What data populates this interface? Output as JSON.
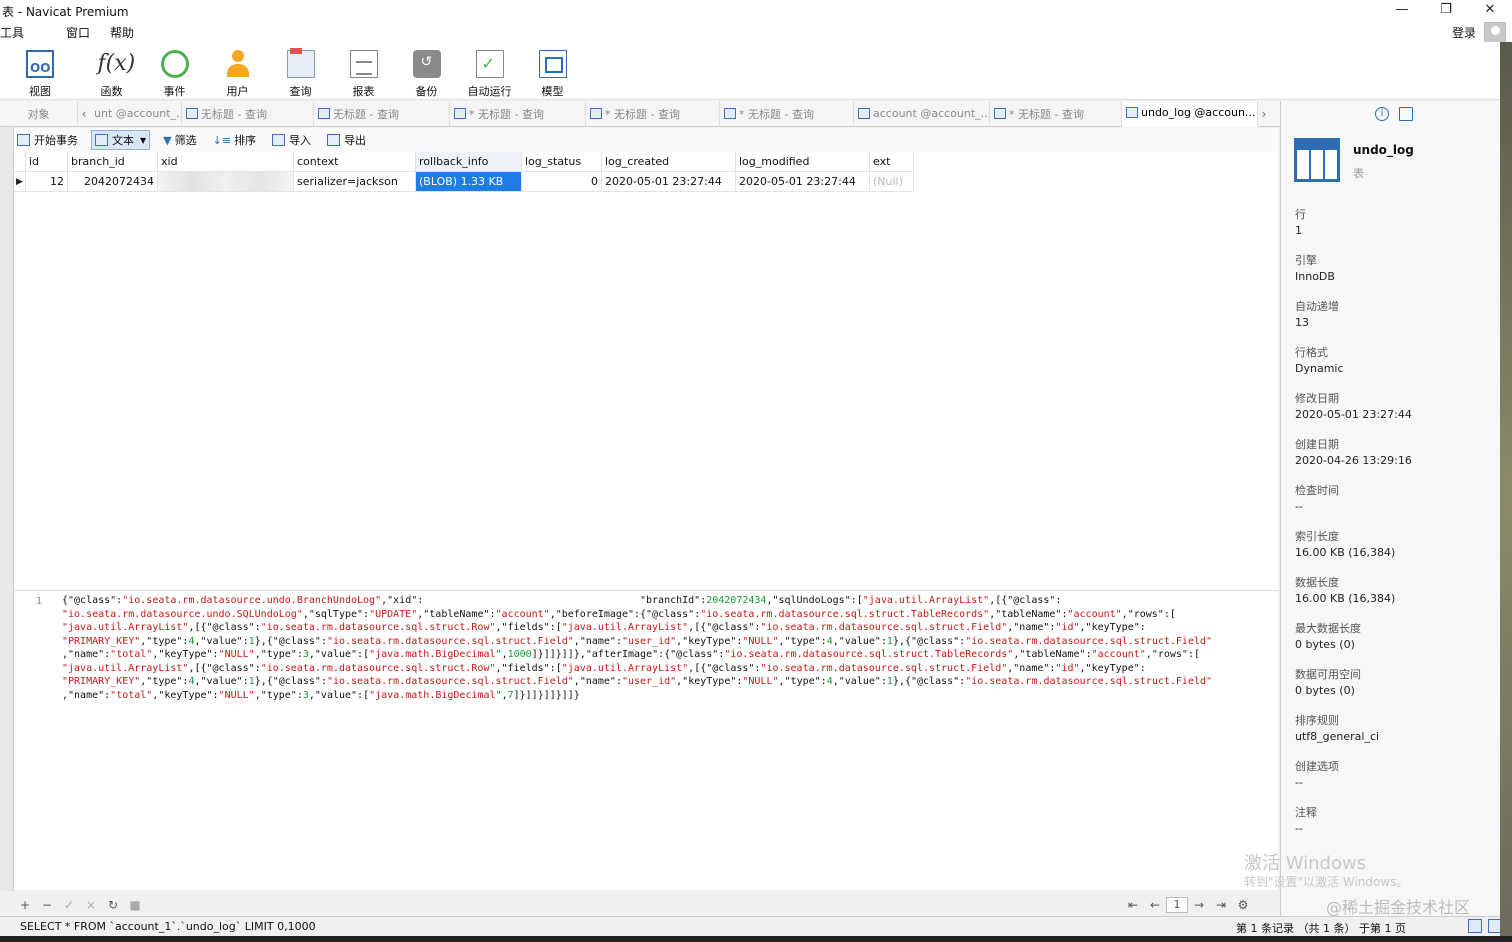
{
  "window": {
    "title": "表 - Navicat Premium",
    "controls": [
      "—",
      "❐",
      "✕"
    ]
  },
  "menu": [
    "工具",
    "窗口",
    "帮助"
  ],
  "login_label": "登录",
  "toolbar": [
    {
      "label": "视图",
      "icon": "view-icon"
    },
    {
      "label": "函数",
      "icon": "function-icon"
    },
    {
      "label": "事件",
      "icon": "event-icon"
    },
    {
      "label": "用户",
      "icon": "user-icon"
    },
    {
      "label": "查询",
      "icon": "query-icon"
    },
    {
      "label": "报表",
      "icon": "report-icon"
    },
    {
      "label": "备份",
      "icon": "backup-icon"
    },
    {
      "label": "自动运行",
      "icon": "auto-run-icon"
    },
    {
      "label": "模型",
      "icon": "model-icon"
    }
  ],
  "tabs": {
    "objects_label": "对象",
    "items": [
      {
        "label": "unt @account_..."
      },
      {
        "label": "无标题 - 查询"
      },
      {
        "label": "无标题 - 查询"
      },
      {
        "label": "* 无标题 - 查询"
      },
      {
        "label": "* 无标题 - 查询"
      },
      {
        "label": "* 无标题 - 查询"
      },
      {
        "label": "account @account_..."
      },
      {
        "label": "* 无标题 - 查询"
      },
      {
        "label": "undo_log @accoun..."
      }
    ]
  },
  "subtoolbar": {
    "begin_tx": "开始事务",
    "text": "文本",
    "filter": "筛选",
    "sort": "排序",
    "import": "导入",
    "export": "导出"
  },
  "grid": {
    "columns": [
      "id",
      "branch_id",
      "xid",
      "context",
      "rollback_info",
      "log_status",
      "log_created",
      "log_modified",
      "ext"
    ],
    "rows": [
      {
        "id": "12",
        "branch_id": "2042072434",
        "xid": "",
        "context": "serializer=jackson",
        "rollback_info": "(BLOB) 1.33 KB",
        "log_status": "0",
        "log_created": "2020-05-01 23:27:44",
        "log_modified": "2020-05-01 23:27:44",
        "ext": "(Null)"
      }
    ]
  },
  "viewer": {
    "line_number": "1",
    "segments": [
      {
        "t": "{\"@class\":"
      },
      {
        "t": "\"io.seata.rm.datasource.undo.BranchUndoLog\"",
        "c": "s"
      },
      {
        "t": ",\"xid\":                                    \"branchId\":"
      },
      {
        "t": "2042072434",
        "c": "n"
      },
      {
        "t": ",\"sqlUndoLogs\":["
      },
      {
        "t": "\"java.util.ArrayList\"",
        "c": "s"
      },
      {
        "t": ",[{\"@class\":\n"
      },
      {
        "t": "\"io.seata.rm.datasource.undo.SQLUndoLog\"",
        "c": "s"
      },
      {
        "t": ",\"sqlType\":"
      },
      {
        "t": "\"UPDATE\"",
        "c": "s"
      },
      {
        "t": ",\"tableName\":"
      },
      {
        "t": "\"account\"",
        "c": "s"
      },
      {
        "t": ",\"beforeImage\":{\"@class\":"
      },
      {
        "t": "\"io.seata.rm.datasource.sql.struct.TableRecords\"",
        "c": "s"
      },
      {
        "t": ",\"tableName\":"
      },
      {
        "t": "\"account\"",
        "c": "s"
      },
      {
        "t": ",\"rows\":[\n"
      },
      {
        "t": "\"java.util.ArrayList\"",
        "c": "s"
      },
      {
        "t": ",[{\"@class\":"
      },
      {
        "t": "\"io.seata.rm.datasource.sql.struct.Row\"",
        "c": "s"
      },
      {
        "t": ",\"fields\":["
      },
      {
        "t": "\"java.util.ArrayList\"",
        "c": "s"
      },
      {
        "t": ",[{\"@class\":"
      },
      {
        "t": "\"io.seata.rm.datasource.sql.struct.Field\"",
        "c": "s"
      },
      {
        "t": ",\"name\":"
      },
      {
        "t": "\"id\"",
        "c": "s"
      },
      {
        "t": ",\"keyType\":\n"
      },
      {
        "t": "\"PRIMARY_KEY\"",
        "c": "s"
      },
      {
        "t": ",\"type\":"
      },
      {
        "t": "4",
        "c": "n"
      },
      {
        "t": ",\"value\":"
      },
      {
        "t": "1",
        "c": "n"
      },
      {
        "t": "},{\"@class\":"
      },
      {
        "t": "\"io.seata.rm.datasource.sql.struct.Field\"",
        "c": "s"
      },
      {
        "t": ",\"name\":"
      },
      {
        "t": "\"user_id\"",
        "c": "s"
      },
      {
        "t": ",\"keyType\":"
      },
      {
        "t": "\"NULL\"",
        "c": "s"
      },
      {
        "t": ",\"type\":"
      },
      {
        "t": "4",
        "c": "n"
      },
      {
        "t": ",\"value\":"
      },
      {
        "t": "1",
        "c": "n"
      },
      {
        "t": "},{\"@class\":"
      },
      {
        "t": "\"io.seata.rm.datasource.sql.struct.Field\"",
        "c": "s"
      },
      {
        "t": "\n"
      },
      {
        "t": ",\"name\":"
      },
      {
        "t": "\"total\"",
        "c": "s"
      },
      {
        "t": ",\"keyType\":"
      },
      {
        "t": "\"NULL\"",
        "c": "s"
      },
      {
        "t": ",\"type\":"
      },
      {
        "t": "3",
        "c": "n"
      },
      {
        "t": ",\"value\":["
      },
      {
        "t": "\"java.math.BigDecimal\"",
        "c": "s"
      },
      {
        "t": ","
      },
      {
        "t": "1000",
        "c": "n"
      },
      {
        "t": "]}]]}]]},\"afterImage\":{\"@class\":"
      },
      {
        "t": "\"io.seata.rm.datasource.sql.struct.TableRecords\"",
        "c": "s"
      },
      {
        "t": ",\"tableName\":"
      },
      {
        "t": "\"account\"",
        "c": "s"
      },
      {
        "t": ",\"rows\":[\n"
      },
      {
        "t": "\"java.util.ArrayList\"",
        "c": "s"
      },
      {
        "t": ",[{\"@class\":"
      },
      {
        "t": "\"io.seata.rm.datasource.sql.struct.Row\"",
        "c": "s"
      },
      {
        "t": ",\"fields\":["
      },
      {
        "t": "\"java.util.ArrayList\"",
        "c": "s"
      },
      {
        "t": ",[{\"@class\":"
      },
      {
        "t": "\"io.seata.rm.datasource.sql.struct.Field\"",
        "c": "s"
      },
      {
        "t": ",\"name\":"
      },
      {
        "t": "\"id\"",
        "c": "s"
      },
      {
        "t": ",\"keyType\":\n"
      },
      {
        "t": "\"PRIMARY_KEY\"",
        "c": "s"
      },
      {
        "t": ",\"type\":"
      },
      {
        "t": "4",
        "c": "n"
      },
      {
        "t": ",\"value\":"
      },
      {
        "t": "1",
        "c": "n"
      },
      {
        "t": "},{\"@class\":"
      },
      {
        "t": "\"io.seata.rm.datasource.sql.struct.Field\"",
        "c": "s"
      },
      {
        "t": ",\"name\":"
      },
      {
        "t": "\"user_id\"",
        "c": "s"
      },
      {
        "t": ",\"keyType\":"
      },
      {
        "t": "\"NULL\"",
        "c": "s"
      },
      {
        "t": ",\"type\":"
      },
      {
        "t": "4",
        "c": "n"
      },
      {
        "t": ",\"value\":"
      },
      {
        "t": "1",
        "c": "n"
      },
      {
        "t": "},{\"@class\":"
      },
      {
        "t": "\"io.seata.rm.datasource.sql.struct.Field\"",
        "c": "s"
      },
      {
        "t": "\n"
      },
      {
        "t": ",\"name\":"
      },
      {
        "t": "\"total\"",
        "c": "s"
      },
      {
        "t": ",\"keyType\":"
      },
      {
        "t": "\"NULL\"",
        "c": "s"
      },
      {
        "t": ",\"type\":"
      },
      {
        "t": "3",
        "c": "n"
      },
      {
        "t": ",\"value\":["
      },
      {
        "t": "\"java.math.BigDecimal\"",
        "c": "s"
      },
      {
        "t": ","
      },
      {
        "t": "7",
        "c": "n"
      },
      {
        "t": "]}]]}]]}]]}"
      }
    ]
  },
  "bottom_nav": {
    "add": "+",
    "remove": "−",
    "apply": "✓",
    "discard": "×",
    "refresh": "↻",
    "stop": "■",
    "first": "⇤",
    "prev": "←",
    "page": "1",
    "next": "→",
    "last": "⇥",
    "settings": "⚙"
  },
  "statusbar": {
    "sql": "SELECT * FROM `account_1`.`undo_log` LIMIT 0,1000",
    "records": "第 1 条记录 （共 1 条） 于第 1 页"
  },
  "right_panel": {
    "table_name": "undo_log",
    "table_type": "表",
    "properties": [
      {
        "k": "行",
        "v": "1"
      },
      {
        "k": "引擎",
        "v": "InnoDB"
      },
      {
        "k": "自动递增",
        "v": "13"
      },
      {
        "k": "行格式",
        "v": "Dynamic"
      },
      {
        "k": "修改日期",
        "v": "2020-05-01 23:27:44"
      },
      {
        "k": "创建日期",
        "v": "2020-04-26 13:29:16"
      },
      {
        "k": "检查时间",
        "v": "--"
      },
      {
        "k": "索引长度",
        "v": "16.00 KB (16,384)"
      },
      {
        "k": "数据长度",
        "v": "16.00 KB (16,384)"
      },
      {
        "k": "最大数据长度",
        "v": "0 bytes (0)"
      },
      {
        "k": "数据可用空间",
        "v": "0 bytes (0)"
      },
      {
        "k": "排序规则",
        "v": "utf8_general_ci"
      },
      {
        "k": "创建选项",
        "v": "--"
      },
      {
        "k": "注释",
        "v": "--"
      }
    ]
  },
  "watermarks": {
    "activate_title": "激活 Windows",
    "activate_sub": "转到\"设置\"以激活 Windows。",
    "site": "@稀土掘金技术社区"
  },
  "colors": {
    "selection": "#1e7de2",
    "string": "#c41a16",
    "number": "#1c9c3b",
    "accent": "#2e6db4"
  }
}
